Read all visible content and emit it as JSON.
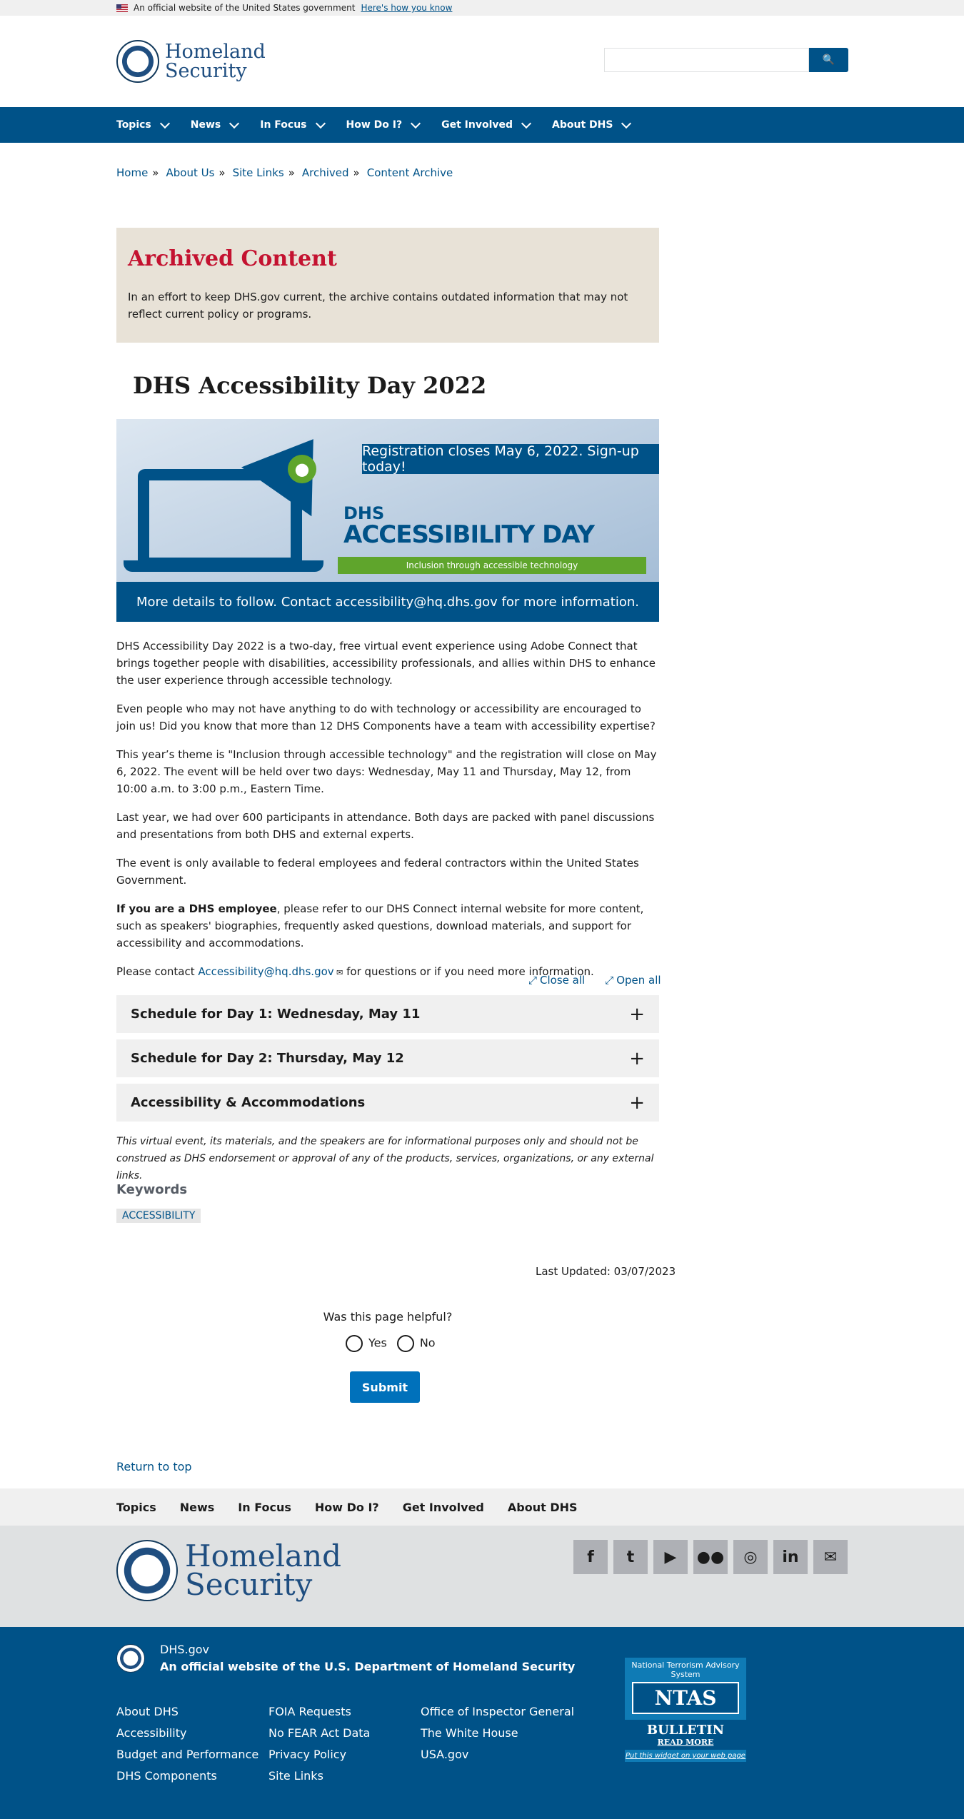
{
  "gov_banner": {
    "text": "An official website of the United States government",
    "link": "Here's how you know"
  },
  "header": {
    "logo_line1": "Homeland",
    "logo_line2": "Security",
    "search_icon": "search-icon",
    "search_button": "🔍"
  },
  "nav": {
    "items": [
      "Topics",
      "News",
      "In Focus",
      "How Do I?",
      "Get Involved",
      "About DHS"
    ]
  },
  "breadcrumb": [
    "Home",
    "About Us",
    "Site Links",
    "Archived",
    "Content Archive"
  ],
  "breadcrumb_sep": "»",
  "archived": {
    "title": "Archived Content",
    "text": "In an effort to keep DHS.gov current, the archive contains outdated information that may not reflect current policy or programs."
  },
  "page_title": "DHS Accessibility Day 2022",
  "hero": {
    "registration": "Registration closes May 6, 2022. Sign-up today!",
    "dhs": "DHS",
    "accessibility_day": "ACCESSIBILITY DAY",
    "tagline": "Inclusion through accessible technology",
    "footer": "More details to follow. Contact accessibility@hq.dhs.gov for more information."
  },
  "body": {
    "p1": "DHS Accessibility Day 2022 is a two-day, free virtual event experience using Adobe Connect that brings together people with disabilities, accessibility professionals, and allies within DHS to enhance the user experience through accessible technology.",
    "p2": "Even people who may not have anything to do with technology or accessibility are encouraged to join us! Did you know that more than 12 DHS Components have a team with accessibility expertise?",
    "p3": "This year’s theme is \"Inclusion through accessible technology\" and the registration will close on May 6, 2022. The event will be held over two days: Wednesday, May 11 and Thursday, May 12, from 10:00 a.m. to 3:00 p.m., Eastern Time.",
    "p4": "Last year, we had over 600 participants in attendance. Both days are packed with panel discussions and presentations from both DHS and external experts.",
    "p5": "The event is only available to federal employees and federal contractors within the United States Government.",
    "p6_bold": "If you are a DHS employee",
    "p6_rest": ", please refer to our DHS Connect internal website for more content, such as speakers' biographies, frequently asked questions, download materials, and support for accessibility and accommodations.",
    "p7_pre": "Please contact ",
    "p7_link": "Accessibility@hq.dhs.gov",
    "p7_post": " for questions or if you need more information."
  },
  "toggles": {
    "close_all": "Close all",
    "open_all": "Open all"
  },
  "accordion": [
    "Schedule for Day 1: Wednesday, May 11",
    "Schedule for Day 2: Thursday, May 12",
    "Accessibility & Accommodations"
  ],
  "disclaimer": "This virtual event, its materials, and the speakers are for informational purposes only and should not be construed as DHS endorsement or approval of any of the products, services, organizations, or any external links.",
  "keywords": {
    "title": "Keywords",
    "tags": [
      "ACCESSIBILITY"
    ]
  },
  "last_updated": "Last Updated: 03/07/2023",
  "feedback": {
    "question": "Was this page helpful?",
    "yes": "Yes",
    "no": "No",
    "submit": "Submit"
  },
  "return_top": "Return to top",
  "footer_nav": [
    "Topics",
    "News",
    "In Focus",
    "How Do I?",
    "Get Involved",
    "About DHS"
  ],
  "social": [
    "f",
    "t",
    "▶",
    "●●",
    "◎",
    "in",
    "✉"
  ],
  "footer": {
    "site": "DHS.gov",
    "official_pre": "An official website of the ",
    "official_link": "U.S. Department of Homeland Security",
    "col1": [
      "About DHS",
      "Accessibility",
      "Budget and Performance",
      "DHS Components"
    ],
    "col2": [
      "FOIA Requests",
      "No FEAR Act Data",
      "Privacy Policy",
      "Site Links"
    ],
    "col3": [
      "Office of Inspector General",
      "The White House",
      "USA.gov"
    ]
  },
  "ntas": {
    "header": "National Terrorism Advisory System",
    "logo": "NTAS",
    "bulletin": "BULLETIN",
    "read_more": "READ MORE",
    "widget": "Put this widget on your web page"
  }
}
